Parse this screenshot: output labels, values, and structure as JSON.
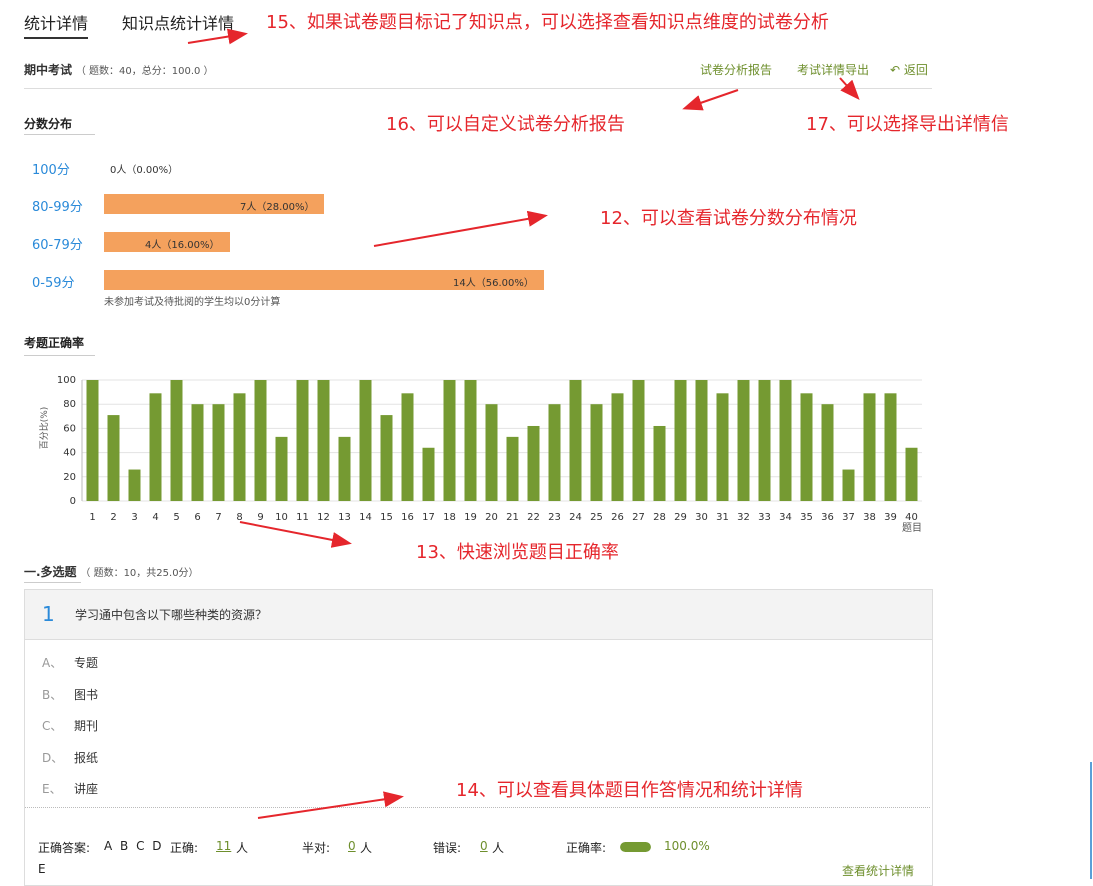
{
  "tabs": [
    "统计详情",
    "知识点统计详情"
  ],
  "exam": {
    "title": "期中考试",
    "meta": "（ 题数：40，总分：100.0 ）"
  },
  "actions": {
    "report": "试卷分析报告",
    "export": "考试详情导出",
    "back": "返回"
  },
  "score_dist": {
    "title": "分数分布",
    "rows": [
      {
        "label": "100分",
        "text": "0人（0.00%）",
        "fraction": 0
      },
      {
        "label": "80-99分",
        "text": "7人（28.00%）",
        "fraction": 0.28
      },
      {
        "label": "60-79分",
        "text": "4人（16.00%）",
        "fraction": 0.16
      },
      {
        "label": "0-59分",
        "text": "14人（56.00%）",
        "fraction": 0.56
      }
    ],
    "note": "未参加考试及待批阅的学生均以0分计算"
  },
  "accuracy_title": "考题正确率",
  "chart_data": {
    "type": "bar",
    "ylabel": "百分比(%)",
    "xlabel": "题目",
    "ylim": [
      0,
      100
    ],
    "yticks": [
      0,
      20,
      40,
      60,
      80,
      100
    ],
    "categories": [
      "1",
      "2",
      "3",
      "4",
      "5",
      "6",
      "7",
      "8",
      "9",
      "10",
      "11",
      "12",
      "13",
      "14",
      "15",
      "16",
      "17",
      "18",
      "19",
      "20",
      "21",
      "22",
      "23",
      "24",
      "25",
      "26",
      "27",
      "28",
      "29",
      "30",
      "31",
      "32",
      "33",
      "34",
      "35",
      "36",
      "37",
      "38",
      "39",
      "40"
    ],
    "values": [
      100,
      71,
      26,
      89,
      100,
      80,
      80,
      89,
      100,
      53,
      100,
      100,
      53,
      100,
      71,
      89,
      44,
      100,
      100,
      80,
      53,
      62,
      80,
      100,
      80,
      89,
      100,
      62,
      100,
      100,
      89,
      100,
      100,
      100,
      89,
      80,
      26,
      89,
      89,
      44
    ],
    "color": "#759a32",
    "grid": true
  },
  "section": {
    "title": "一.多选题",
    "meta": "（ 题数：10，共25.0分）"
  },
  "question": {
    "number": "1",
    "text": "学习通中包含以下哪些种类的资源？",
    "options": [
      {
        "letter": "A、",
        "text": "专题"
      },
      {
        "letter": "B、",
        "text": "图书"
      },
      {
        "letter": "C、",
        "text": "期刊"
      },
      {
        "letter": "D、",
        "text": "报纸"
      },
      {
        "letter": "E、",
        "text": "讲座"
      }
    ]
  },
  "stats": {
    "answer_label": "正确答案:",
    "answer_line1": "A B C D",
    "answer_line2": "E",
    "correct_label": "正确:",
    "correct_value": "11",
    "half_label": "半对:",
    "half_value": "0",
    "wrong_label": "错误:",
    "wrong_value": "0",
    "unit": "人",
    "rate_label": "正确率:",
    "rate_value": "100.0%",
    "rate_fraction": 1.0,
    "detail_link": "查看统计详情"
  },
  "annotations": [
    "15、如果试卷题目标记了知识点，可以选择查看知识点维度的试卷分析",
    "16、可以自定义试卷分析报告",
    "17、可以选择导出详情信",
    "12、可以查看试卷分数分布情况",
    "13、快速浏览题目正确率",
    "14、可以查看具体题目作答情况和统计详情"
  ],
  "colors": {
    "accent_green": "#6e8f2d",
    "bar_orange": "#f4a15d",
    "annotation_red": "#e5262c",
    "link_blue": "#2a8ad9"
  }
}
